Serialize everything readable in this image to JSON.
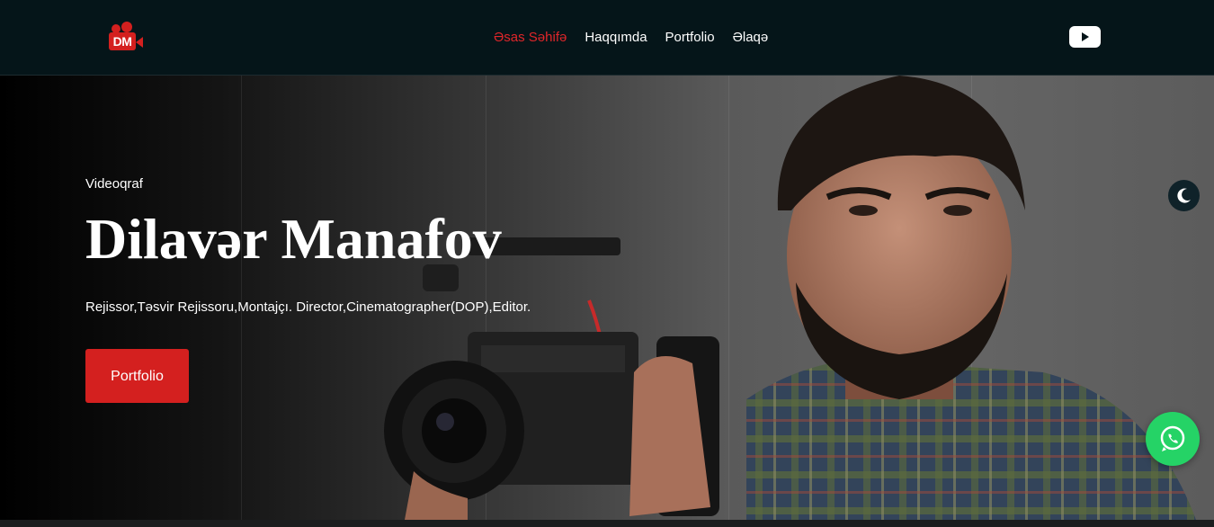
{
  "nav": {
    "logo_text": "DM",
    "links": [
      {
        "label": "Əsas Səhifə",
        "active": true
      },
      {
        "label": "Haqqımda",
        "active": false
      },
      {
        "label": "Portfolio",
        "active": false
      },
      {
        "label": "Əlaqə",
        "active": false
      }
    ],
    "social_icon": "youtube-icon"
  },
  "hero": {
    "eyebrow": "Videoqraf",
    "title": "Dilavər Manafov",
    "subtitle": "Rejissor,Təsvir Rejissoru,Montajçı. Director,Cinematographer(DOP),Editor.",
    "cta_label": "Portfolio"
  },
  "floating": {
    "theme_icon": "moon-icon",
    "chat_icon": "whatsapp-icon"
  },
  "colors": {
    "accent": "#d4201f",
    "nav_bg": "#051519",
    "whatsapp": "#25d366"
  }
}
